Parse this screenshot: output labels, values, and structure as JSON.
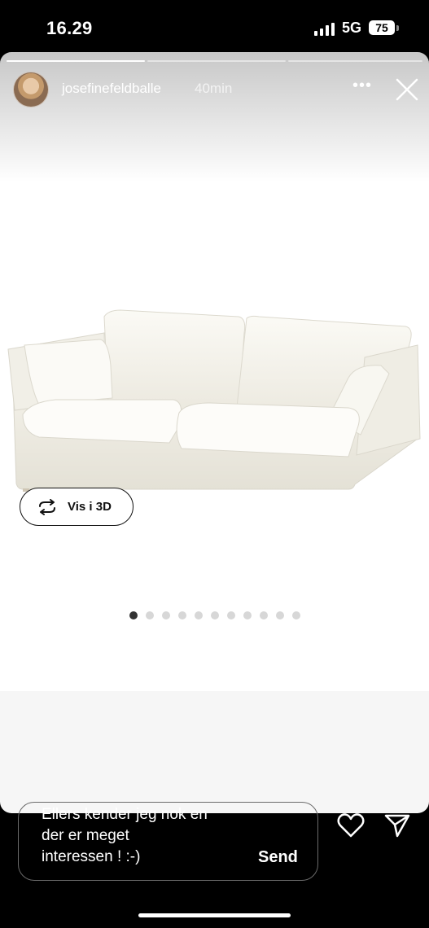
{
  "status_bar": {
    "time": "16.29",
    "network": "5G",
    "battery": "75"
  },
  "story": {
    "username": "josefinefeldballe",
    "age": "40min",
    "progress_segments": [
      1,
      0,
      0
    ],
    "carousel": {
      "button_label": "Vis i 3D",
      "dot_count": 11,
      "active_index": 0
    }
  },
  "reply": {
    "text_lines": [
      "Ellers kender jeg nok en",
      "der er meget",
      "interessen ! :-)"
    ],
    "send_label": "Send"
  },
  "icons": [
    "signal-icon",
    "battery-icon",
    "avatar",
    "more-icon",
    "close-icon",
    "rotate-3d-icon",
    "heart-icon",
    "share-icon"
  ]
}
